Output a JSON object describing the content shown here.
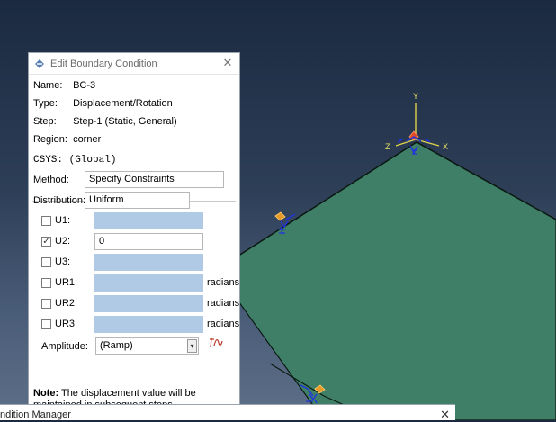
{
  "dialog": {
    "title": "Edit Boundary Condition",
    "close_icon": "close-icon",
    "name_label": "Name:",
    "name_value": "BC-3",
    "type_label": "Type:",
    "type_value": "Displacement/Rotation",
    "step_label": "Step:",
    "step_value": "Step-1 (Static, General)",
    "region_label": "Region:",
    "region_value": "corner",
    "csys": "CSYS: (Global)",
    "method_label": "Method:",
    "method_value": "Specify Constraints",
    "distribution_label": "Distribution:",
    "distribution_value": "Uniform",
    "dofs": [
      {
        "label": "U1:",
        "checked": false,
        "value": "",
        "unit": ""
      },
      {
        "label": "U2:",
        "checked": true,
        "value": "0",
        "unit": ""
      },
      {
        "label": "U3:",
        "checked": false,
        "value": "",
        "unit": ""
      },
      {
        "label": "UR1:",
        "checked": false,
        "value": "",
        "unit": "radians"
      },
      {
        "label": "UR2:",
        "checked": false,
        "value": "",
        "unit": "radians"
      },
      {
        "label": "UR3:",
        "checked": false,
        "value": "",
        "unit": "radians"
      }
    ],
    "amplitude_label": "Amplitude:",
    "amplitude_value": "(Ramp)",
    "note_bold": "Note:",
    "note_text": "The displacement value will be maintained in subsequent steps."
  },
  "manager": {
    "title": "ndition Manager"
  },
  "viewport": {
    "axis_y": "Y",
    "axis_x": "X",
    "axis_z": "Z",
    "plate_color": "#3f7f68"
  }
}
